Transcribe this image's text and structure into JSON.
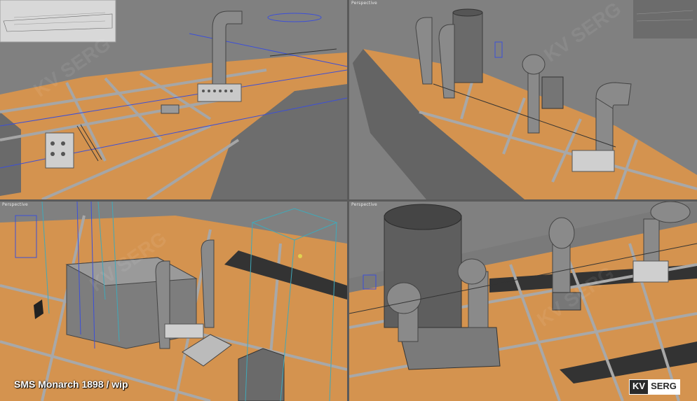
{
  "viewports": {
    "top_left": {
      "label": ""
    },
    "top_right": {
      "label": "Perspective"
    },
    "bottom_left": {
      "label": "Perspective"
    },
    "bottom_right": {
      "label": "Perspective"
    }
  },
  "caption": "SMS Monarch 1898 / wip",
  "logo": {
    "left": "KV",
    "right": "SERG"
  },
  "watermark": "KV SERG",
  "colors": {
    "deck": "#d4934f",
    "plank_lines": "#a9a9a9",
    "hull": "#6e6e6e",
    "metal": "#7a7a7a",
    "background": "#808080",
    "helper_blue": "#3c4fd8",
    "helper_cyan": "#3fa9b9"
  }
}
